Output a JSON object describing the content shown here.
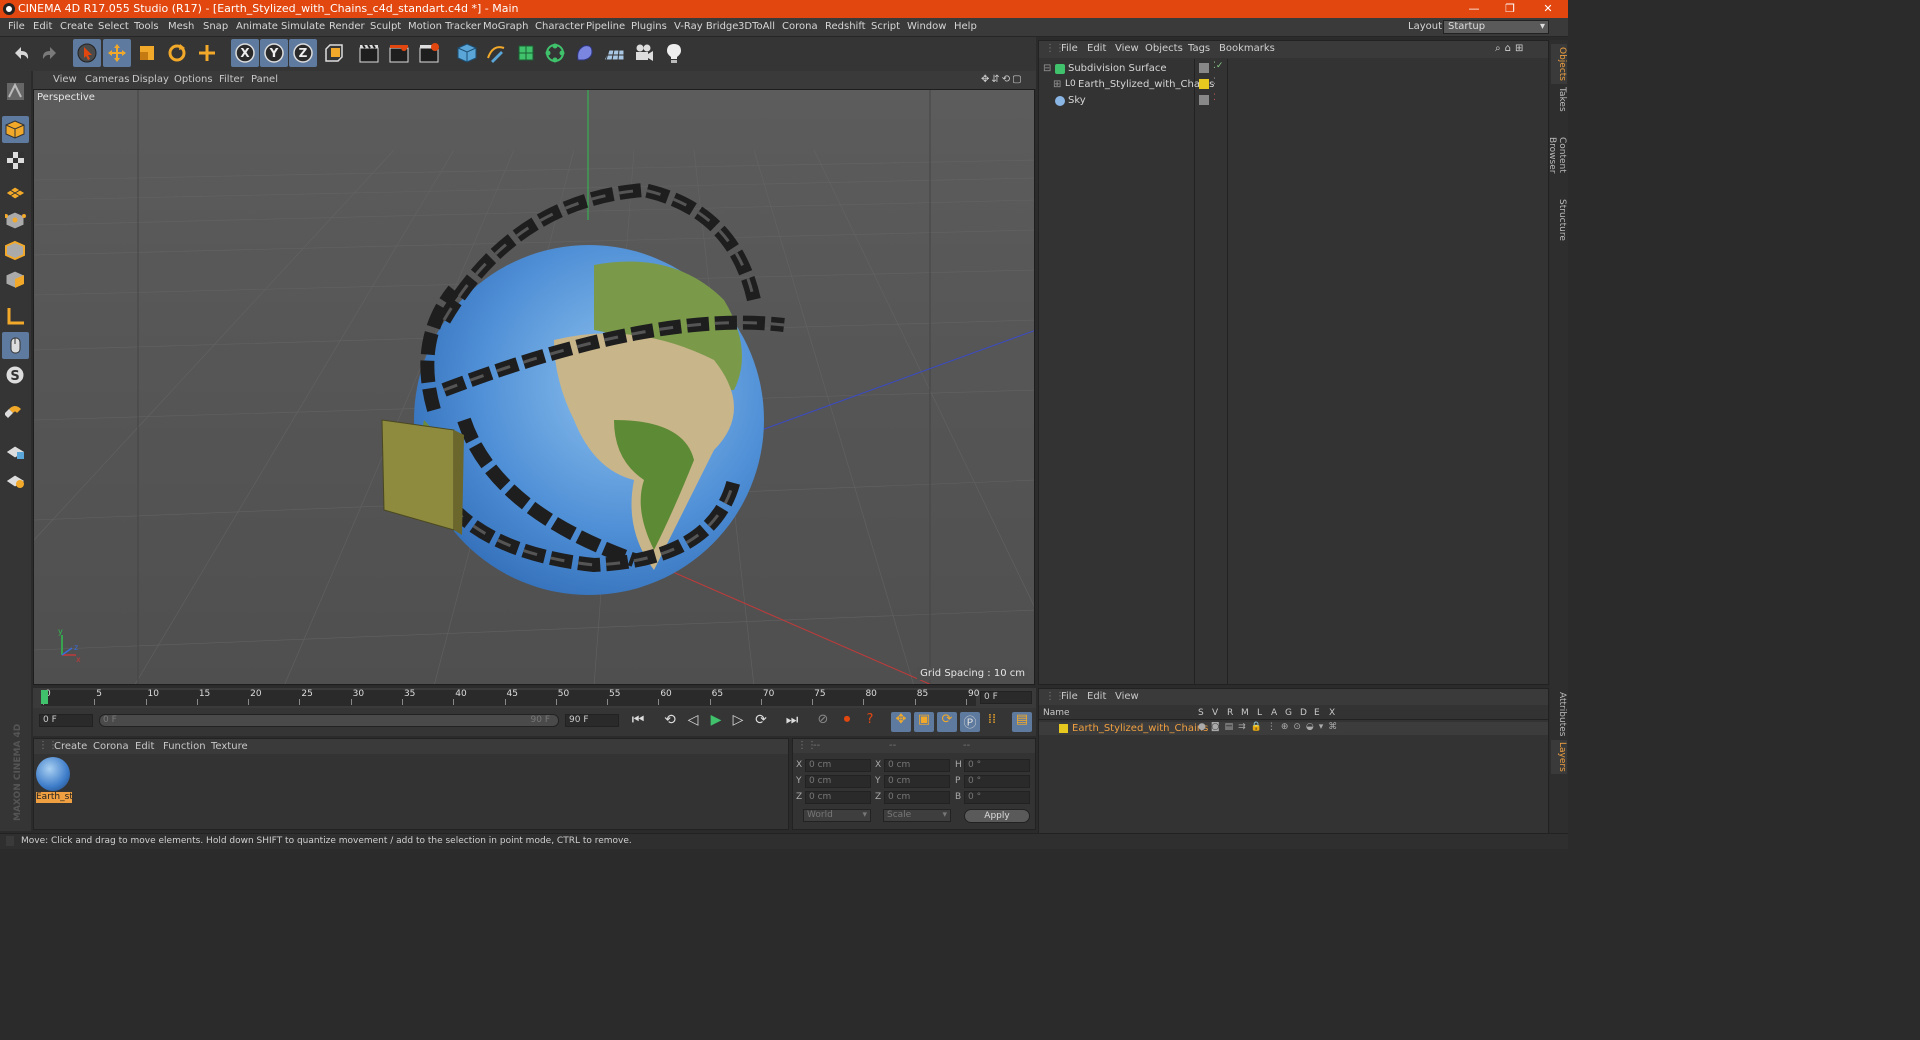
{
  "window": {
    "title": "CINEMA 4D R17.055 Studio (R17) - [Earth_Stylized_with_Chains_c4d_standart.c4d *] - Main",
    "controls": {
      "minimize": "—",
      "restore": "❐",
      "close": "✕"
    }
  },
  "menu": {
    "items": [
      "File",
      "Edit",
      "Create",
      "Select",
      "Tools",
      "Mesh",
      "Snap",
      "Animate",
      "Simulate",
      "Render",
      "Sculpt",
      "Motion Tracker",
      "MoGraph",
      "Character",
      "Pipeline",
      "Plugins",
      "V-Ray Bridge",
      "3DToAll",
      "Corona",
      "Redshift",
      "Script",
      "Window",
      "Help"
    ],
    "layout_label": "Layout:",
    "layout_value": "Startup"
  },
  "toolbar": {
    "icons": [
      "undo-icon",
      "redo-icon",
      "select-arrow-icon",
      "move-icon",
      "scale-icon",
      "rotate-icon",
      "transform-icon",
      "x-axis-icon",
      "y-axis-icon",
      "z-axis-icon",
      "coordinate-system-icon",
      "render-view-icon",
      "render-picture-viewer-icon",
      "edit-render-settings-icon",
      "cube-primitive-icon",
      "spline-pen-icon",
      "subdivision-nurbs-icon",
      "array-cloner-icon",
      "deformer-icon",
      "floor-scene-icon",
      "camera-icon",
      "light-icon"
    ],
    "axis_letters": [
      "X",
      "Y",
      "Z"
    ]
  },
  "viewport": {
    "menu": [
      "View",
      "Cameras",
      "Display",
      "Options",
      "Filter",
      "Panel"
    ],
    "label": "Perspective",
    "grid_spacing": "Grid Spacing : 10 cm",
    "axis_gizmo": {
      "x": "x",
      "y": "y",
      "z": "z"
    }
  },
  "objects_panel": {
    "menu": [
      "File",
      "Edit",
      "View",
      "Objects",
      "Tags",
      "Bookmarks"
    ],
    "objects": [
      {
        "name": "Subdivision Surface",
        "icon": "subdivision-icon"
      },
      {
        "name": "Earth_Stylized_with_Chains",
        "icon": "null-object-icon"
      },
      {
        "name": "Sky",
        "icon": "sky-icon"
      }
    ]
  },
  "side_tabs": [
    "Objects",
    "Takes",
    "Content Browser",
    "Structure",
    "Attributes",
    "Layers"
  ],
  "layers_panel": {
    "menu": [
      "File",
      "Edit",
      "View"
    ],
    "columns": [
      "Name",
      "S",
      "V",
      "R",
      "M",
      "L",
      "A",
      "G",
      "D",
      "E",
      "X"
    ],
    "layers": [
      {
        "name": "Earth_Stylized_with_Chains",
        "color": "#e6c81e"
      }
    ]
  },
  "timeline": {
    "ticks": [
      "0",
      "5",
      "10",
      "15",
      "20",
      "25",
      "30",
      "35",
      "40",
      "45",
      "50",
      "55",
      "60",
      "65",
      "70",
      "75",
      "80",
      "85",
      "90"
    ],
    "current_frame": "0 F",
    "start_frame": "0 F",
    "range_start": "0 F",
    "range_end": "90 F",
    "end_frame": "90 F"
  },
  "material_manager": {
    "menu": [
      "Create",
      "Corona",
      "Edit",
      "Function",
      "Texture"
    ],
    "materials": [
      {
        "name": "Earth_st"
      }
    ]
  },
  "coordinates": {
    "headers": [
      "--",
      "--",
      "--"
    ],
    "rows": [
      {
        "a_label": "X",
        "a_val": "0 cm",
        "b_label": "X",
        "b_val": "0 cm",
        "c_label": "H",
        "c_val": "0 °"
      },
      {
        "a_label": "Y",
        "a_val": "0 cm",
        "b_label": "Y",
        "b_val": "0 cm",
        "c_label": "P",
        "c_val": "0 °"
      },
      {
        "a_label": "Z",
        "a_val": "0 cm",
        "b_label": "Z",
        "b_val": "0 cm",
        "c_label": "B",
        "c_val": "0 °"
      }
    ],
    "mode": "World",
    "transform": "Scale",
    "apply": "Apply"
  },
  "brand": "MAXON CINEMA 4D",
  "status": "Move: Click and drag to move elements. Hold down SHIFT to quantize movement / add to the selection in point mode, CTRL to remove.",
  "colors": {
    "accent": "#e2470f",
    "selected_blue": "#5e7a9e",
    "layer_yellow": "#e6c81e",
    "highlight_orange": "#f0a040"
  }
}
